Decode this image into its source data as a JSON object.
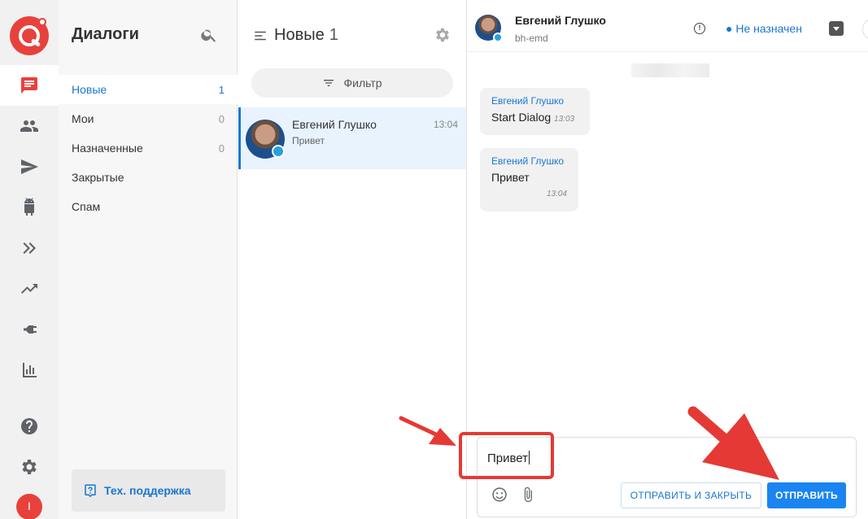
{
  "sidebar": {
    "title": "Диалоги",
    "folders": [
      {
        "label": "Новые",
        "count": "1"
      },
      {
        "label": "Мои",
        "count": "0"
      },
      {
        "label": "Назначенные",
        "count": "0"
      },
      {
        "label": "Закрытые",
        "count": ""
      },
      {
        "label": "Спам",
        "count": ""
      }
    ],
    "support_label": "Тех. поддержка"
  },
  "rail": {
    "icons": [
      "chat-icon",
      "users-icon",
      "send-icon",
      "android-icon",
      "double-chevron-icon",
      "trending-icon",
      "plug-icon",
      "bar-chart-icon",
      "help-icon",
      "settings-icon"
    ],
    "user_initial": "I"
  },
  "conversation_list": {
    "title": "Новые",
    "count": "1",
    "filter_label": "Фильтр",
    "items": [
      {
        "name": "Евгений Глушко",
        "preview": "Привет",
        "time": "13:04"
      }
    ]
  },
  "chat": {
    "contact_name": "Евгений Глушко",
    "contact_sub": "bh-emd",
    "assign_status": "Не назначен",
    "messages": [
      {
        "author": "Евгений Глушко",
        "text": "Start Dialog",
        "time": "13:03"
      },
      {
        "author": "Евгений Глушко",
        "text": "Привет",
        "time": "13:04"
      }
    ],
    "composer": {
      "value": "Привет",
      "send_close_label": "ОТПРАВИТЬ И ЗАКРЫТЬ",
      "send_label": "ОТПРАВИТЬ"
    }
  },
  "colors": {
    "brand_red": "#e8413c",
    "accent_blue": "#1976d2",
    "send_button": "#1a85f0",
    "annotation_red": "#e53935"
  }
}
